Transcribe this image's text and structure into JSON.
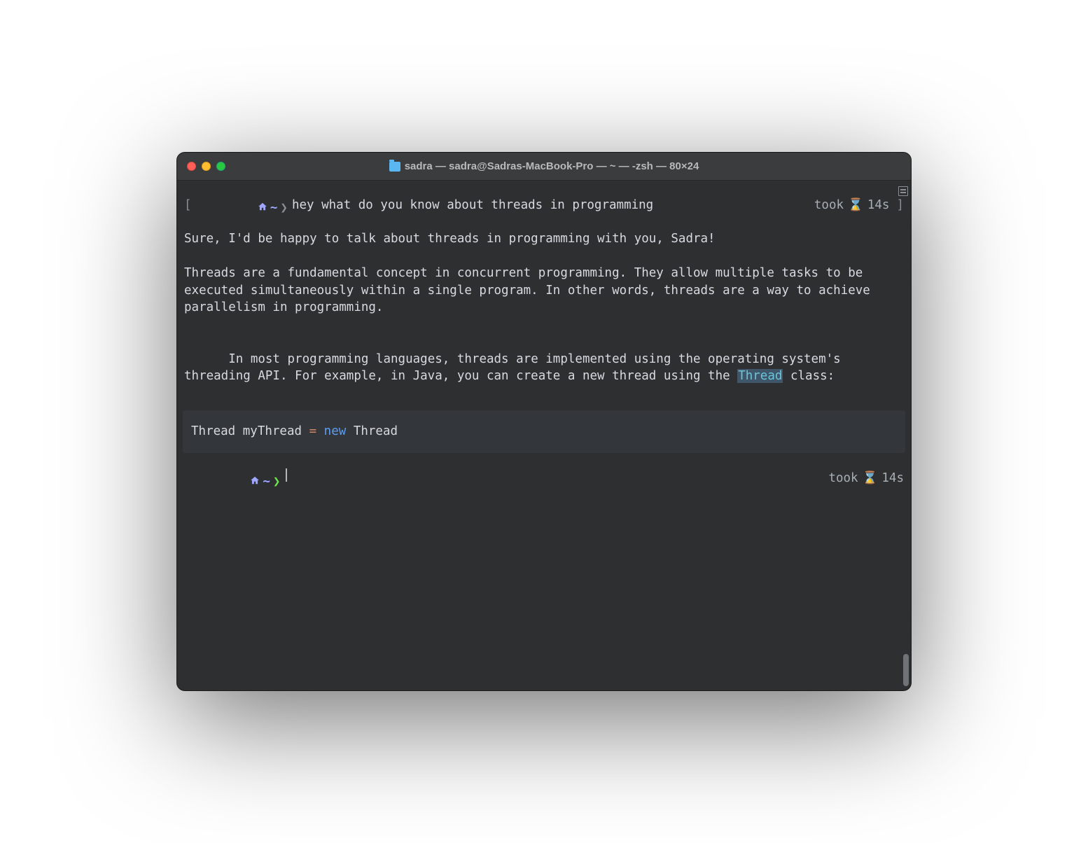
{
  "window": {
    "title": "sadra — sadra@Sadras-MacBook-Pro — ~ — -zsh — 80×24"
  },
  "prompt1": {
    "open_bracket": "[",
    "tilde": "~",
    "chevron": "❯",
    "command": "hey what do you know about threads in programming",
    "took_label": "took",
    "duration": "14s",
    "close_bracket": "]"
  },
  "response": {
    "line1": "Sure, I'd be happy to talk about threads in programming with you, Sadra!",
    "para2": "Threads are a fundamental concept in concurrent programming. They allow multiple tasks to be executed simultaneously within a single program. In other words, threads are a way to achieve parallelism in programming.",
    "para3a": "In most programming languages, threads are implemented using the operating system's threading API. For example, in Java, you can create a new thread using the ",
    "thread_word": "Thread",
    "para3b": " class:"
  },
  "code": {
    "t1": "Thread myThread ",
    "eq": "=",
    "sp": " ",
    "kw": "new",
    "t2": " Thread"
  },
  "prompt2": {
    "tilde": "~",
    "chevron": "❯",
    "took_label": "took",
    "duration": "14s"
  },
  "icons": {
    "apple": "",
    "home": "⌂",
    "hourglass": "⌛"
  }
}
